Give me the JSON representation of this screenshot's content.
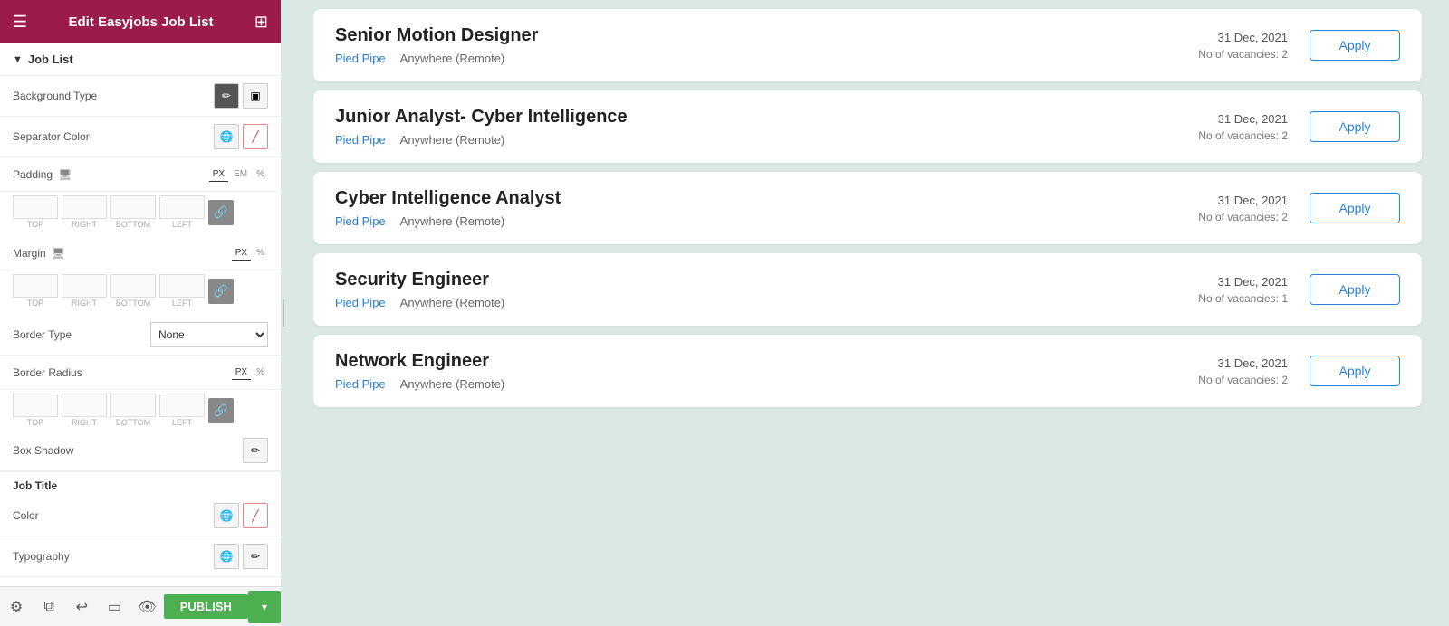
{
  "header": {
    "title": "Edit Easyjobs Job List",
    "menu_icon": "☰",
    "grid_icon": "⊞"
  },
  "sidebar": {
    "section_label": "Job List",
    "settings": {
      "background_type_label": "Background Type",
      "separator_color_label": "Separator Color",
      "padding_label": "Padding",
      "margin_label": "Margin",
      "border_type_label": "Border Type",
      "border_type_value": "None",
      "border_radius_label": "Border Radius",
      "box_shadow_label": "Box Shadow",
      "job_title_label": "Job Title",
      "color_label": "Color",
      "typography_label": "Typography",
      "padding_units": [
        "PX",
        "EM",
        "%"
      ],
      "margin_units": [
        "PX",
        "%"
      ],
      "border_radius_units": [
        "PX",
        "%"
      ]
    },
    "footer": {
      "publish_label": "PUBLISH"
    }
  },
  "jobs": [
    {
      "title": "Senior Motion Designer",
      "company": "Pied Pipe",
      "location": "Anywhere (Remote)",
      "date": "31 Dec, 2021",
      "vacancies": "No of vacancies: 2",
      "apply_label": "Apply"
    },
    {
      "title": "Junior Analyst- Cyber Intelligence",
      "company": "Pied Pipe",
      "location": "Anywhere (Remote)",
      "date": "31 Dec, 2021",
      "vacancies": "No of vacancies: 2",
      "apply_label": "Apply"
    },
    {
      "title": "Cyber Intelligence Analyst",
      "company": "Pied Pipe",
      "location": "Anywhere (Remote)",
      "date": "31 Dec, 2021",
      "vacancies": "No of vacancies: 2",
      "apply_label": "Apply"
    },
    {
      "title": "Security Engineer",
      "company": "Pied Pipe",
      "location": "Anywhere (Remote)",
      "date": "31 Dec, 2021",
      "vacancies": "No of vacancies: 1",
      "apply_label": "Apply"
    },
    {
      "title": "Network Engineer",
      "company": "Pied Pipe",
      "location": "Anywhere (Remote)",
      "date": "31 Dec, 2021",
      "vacancies": "No of vacancies: 2",
      "apply_label": "Apply"
    }
  ]
}
